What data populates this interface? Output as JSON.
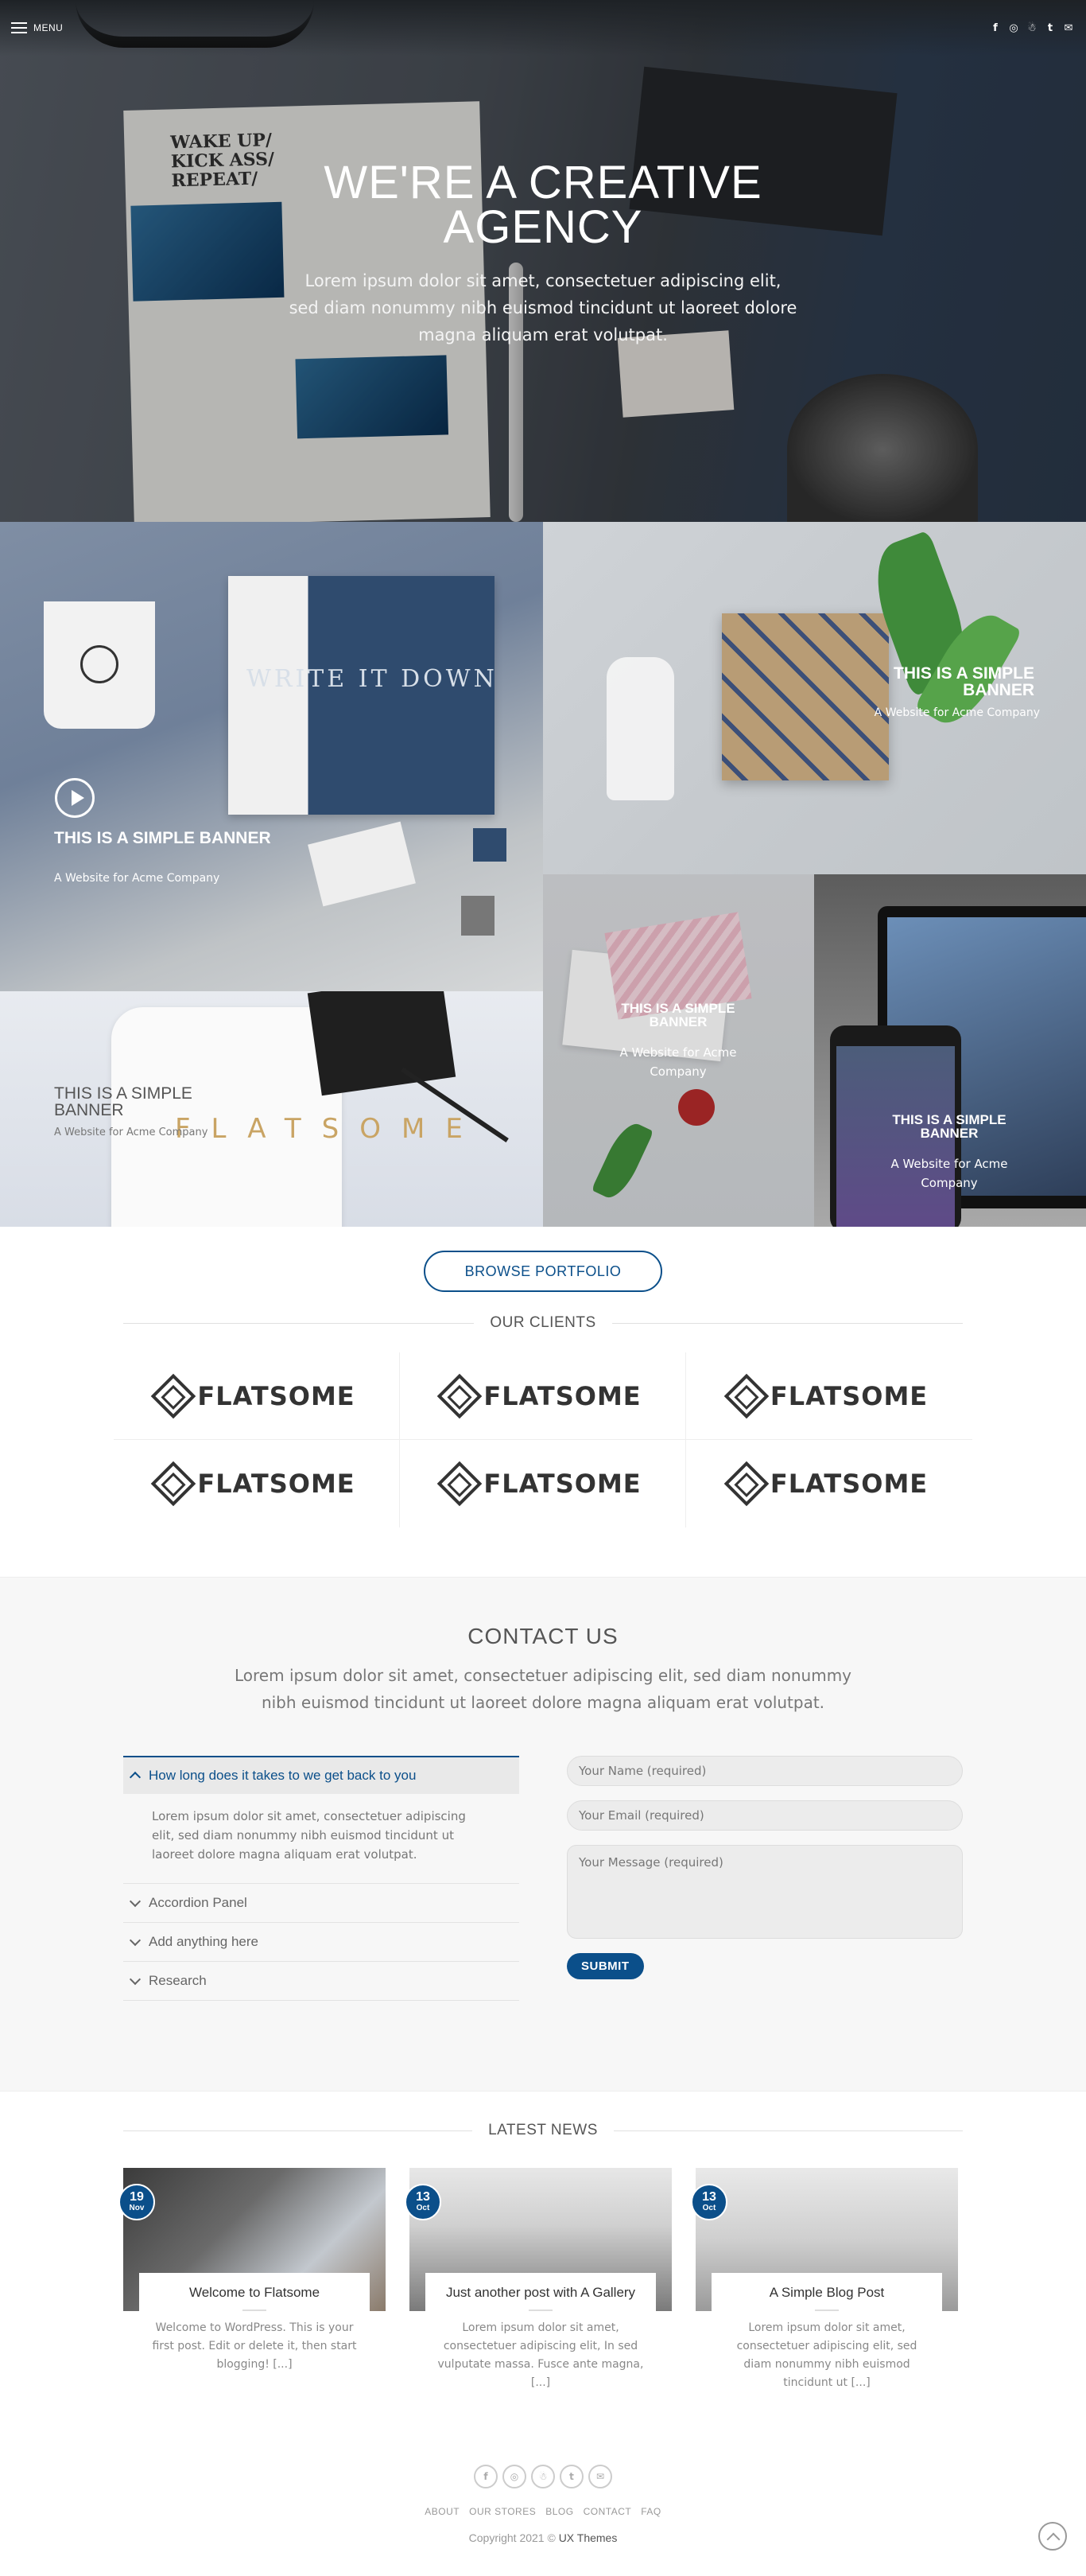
{
  "header": {
    "menu_label": "MENU",
    "social_icons": [
      "facebook-icon",
      "instagram-icon",
      "snapchat-icon",
      "twitter-icon",
      "email-icon"
    ],
    "social_glyphs": [
      "f",
      "◎",
      "☃",
      "t",
      "✉"
    ]
  },
  "hero": {
    "title_line1": "WE'RE A CREATIVE",
    "title_line2": "AGENCY",
    "text": "Lorem ipsum dolor sit amet, consectetuer adipiscing elit, sed diam nonummy nibh euismod tincidunt ut laoreet dolore magna aliquam erat volutpat.",
    "photo_text": {
      "note": "WAKE UP/ KICK ASS/ REPEAT/"
    }
  },
  "banners": [
    {
      "title": "THIS IS A SIMPLE BANNER",
      "subtitle": "A Website for Acme Company",
      "photo_text": "WRITE IT DOWN"
    },
    {
      "title": "THIS IS A SIMPLE BANNER",
      "subtitle": "A Website for Acme Company"
    },
    {
      "title": "THIS IS A SIMPLE BANNER",
      "subtitle": "A Website for Acme Company",
      "photo_text": "FLATSOME"
    },
    {
      "title": "THIS IS A SIMPLE BANNER",
      "subtitle": "A Website for Acme Company"
    },
    {
      "title": "THIS IS A SIMPLE BANNER",
      "subtitle": "A Website for Acme Company"
    }
  ],
  "portfolio": {
    "button_label": "BROWSE PORTFOLIO"
  },
  "clients": {
    "title": "OUR CLIENTS",
    "logos": [
      "FLATSOME",
      "FLATSOME",
      "FLATSOME",
      "FLATSOME",
      "FLATSOME",
      "FLATSOME"
    ]
  },
  "contact": {
    "title": "CONTACT US",
    "lead": "Lorem ipsum dolor sit amet, consectetuer adipiscing elit, sed diam nonummy nibh euismod tincidunt ut laoreet dolore magna aliquam erat volutpat.",
    "accordion": [
      {
        "title": "How long does it takes to we get back to you",
        "body": "Lorem ipsum dolor sit amet, consectetuer adipiscing elit, sed diam nonummy nibh euismod tincidunt ut laoreet dolore magna aliquam erat volutpat.",
        "open": true
      },
      {
        "title": "Accordion Panel"
      },
      {
        "title": "Add anything here"
      },
      {
        "title": "Research"
      }
    ],
    "form": {
      "name_placeholder": "Your Name (required)",
      "email_placeholder": "Your Email (required)",
      "message_placeholder": "Your Message (required)",
      "submit_label": "SUBMIT"
    }
  },
  "news": {
    "title": "LATEST NEWS",
    "posts": [
      {
        "day": "19",
        "month": "Nov",
        "title": "Welcome to Flatsome",
        "excerpt": "Welcome to WordPress. This is your first post. Edit or delete it, then start blogging! [...]"
      },
      {
        "day": "13",
        "month": "Oct",
        "title": "Just another post with A Gallery",
        "excerpt": "Lorem ipsum dolor sit amet, consectetuer adipiscing elit, In sed vulputate massa. Fusce ante magna, [...]"
      },
      {
        "day": "13",
        "month": "Oct",
        "title": "A Simple Blog Post",
        "excerpt": "Lorem ipsum dolor sit amet, consectetuer adipiscing elit, sed diam nonummy nibh euismod tincidunt ut [...]"
      }
    ]
  },
  "footer": {
    "social_icons": [
      "facebook-icon",
      "instagram-icon",
      "snapchat-icon",
      "twitter-icon",
      "email-icon"
    ],
    "social_glyphs": [
      "f",
      "◎",
      "☃",
      "t",
      "✉"
    ],
    "links": [
      "ABOUT",
      "OUR STORES",
      "BLOG",
      "CONTACT",
      "FAQ"
    ],
    "copyright_prefix": "Copyright 2021 ©",
    "copyright_brand": "UX Themes"
  },
  "colors": {
    "primary": "#0b4f8a",
    "text": "#555555",
    "muted": "#777777",
    "section_bg": "#f7f7f7"
  }
}
